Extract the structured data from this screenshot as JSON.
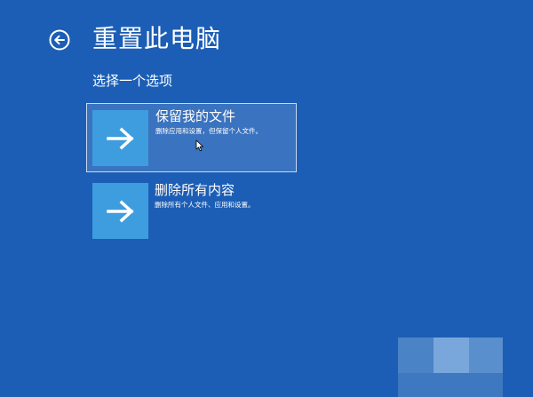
{
  "page": {
    "title": "重置此电脑",
    "subtitle": "选择一个选项"
  },
  "options": [
    {
      "title": "保留我的文件",
      "description": "删除应用和设置，但保留个人文件。",
      "icon": "arrow-right-icon",
      "selected": true
    },
    {
      "title": "删除所有内容",
      "description": "删除所有个人文件、应用和设置。",
      "icon": "arrow-right-icon",
      "selected": false
    }
  ],
  "colors": {
    "background": "#1c5eb5",
    "tile": "#3e9ddf",
    "selected_background": "#3a73bf",
    "selected_border": "#c9d8ee",
    "text": "#ffffff"
  },
  "icons": {
    "back": "back-arrow-circle-icon",
    "cursor": "mouse-pointer-icon"
  }
}
